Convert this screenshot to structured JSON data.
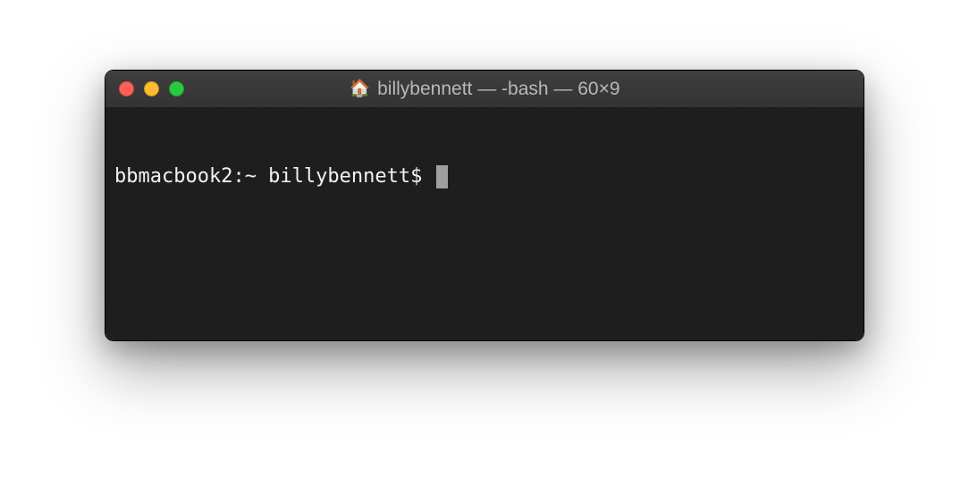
{
  "titlebar": {
    "icon": "🏠",
    "title": "billybennett — -bash — 60×9"
  },
  "terminal": {
    "prompt": "bbmacbook2:~ billybennett$ "
  }
}
